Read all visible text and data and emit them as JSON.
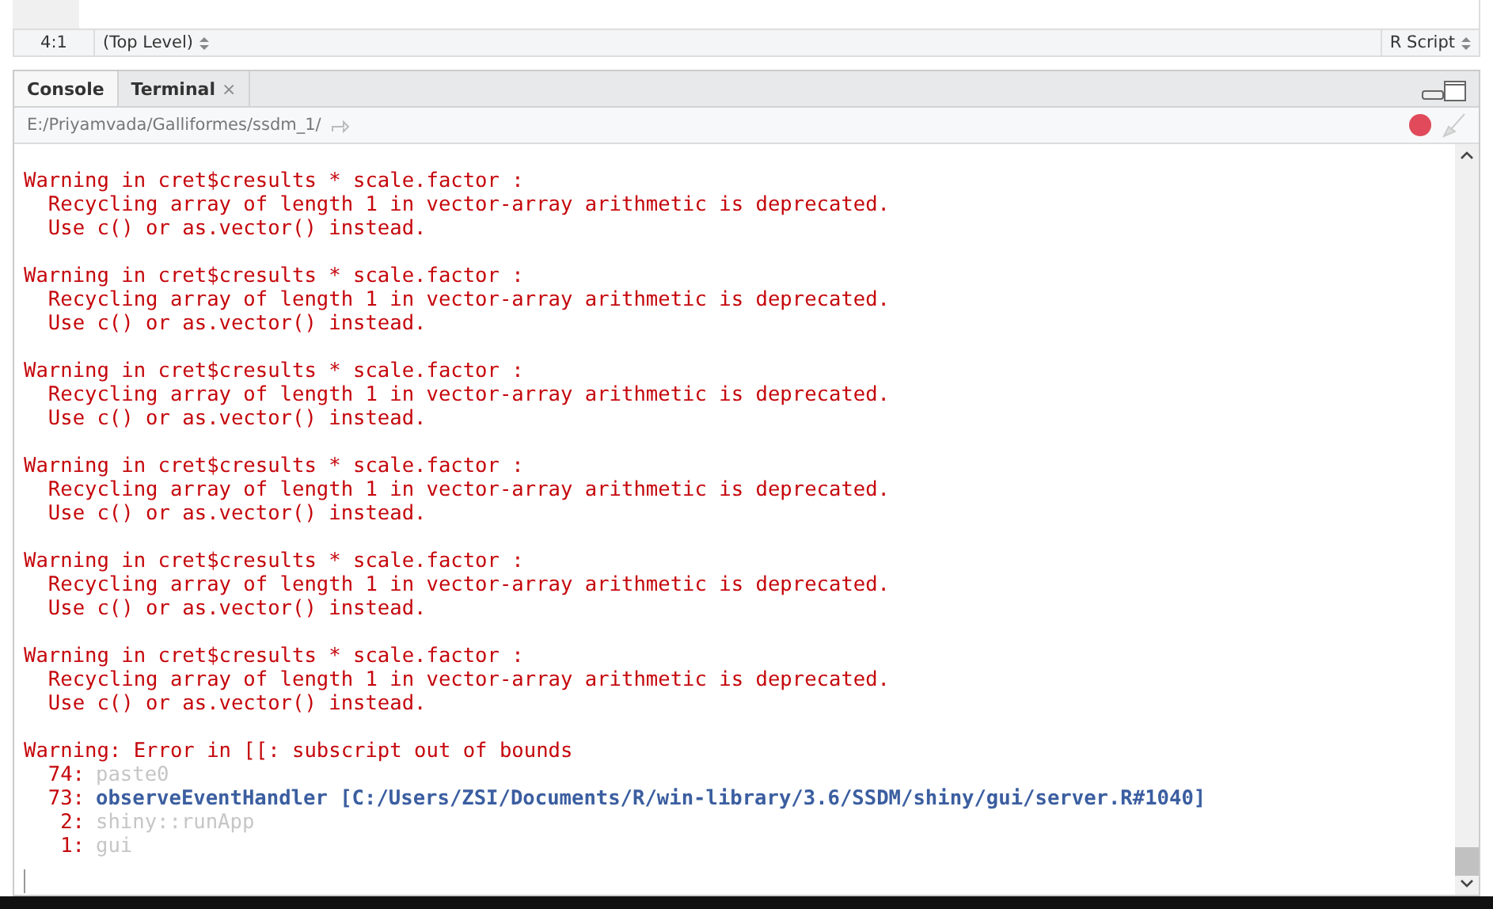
{
  "status_bar": {
    "position": "4:1",
    "scope": "(Top Level)",
    "file_type": "R Script"
  },
  "tabs": [
    {
      "label": "Console",
      "selected": true
    },
    {
      "label": "Terminal",
      "selected": false,
      "close": "×"
    }
  ],
  "path": "E:/Priyamvada/Galliformes/ssdm_1/",
  "console": [
    {
      "kind": "warning",
      "header": "Warning in cret$cresults * scale.factor :",
      "lines": [
        "  Recycling array of length 1 in vector-array arithmetic is deprecated.",
        "  Use c() or as.vector() instead."
      ]
    },
    {
      "kind": "warning",
      "header": "Warning in cret$cresults * scale.factor :",
      "lines": [
        "  Recycling array of length 1 in vector-array arithmetic is deprecated.",
        "  Use c() or as.vector() instead."
      ]
    },
    {
      "kind": "warning",
      "header": "Warning in cret$cresults * scale.factor :",
      "lines": [
        "  Recycling array of length 1 in vector-array arithmetic is deprecated.",
        "  Use c() or as.vector() instead."
      ]
    },
    {
      "kind": "warning",
      "header": "Warning in cret$cresults * scale.factor :",
      "lines": [
        "  Recycling array of length 1 in vector-array arithmetic is deprecated.",
        "  Use c() or as.vector() instead."
      ]
    },
    {
      "kind": "warning",
      "header": "Warning in cret$cresults * scale.factor :",
      "lines": [
        "  Recycling array of length 1 in vector-array arithmetic is deprecated.",
        "  Use c() or as.vector() instead."
      ]
    },
    {
      "kind": "warning",
      "header": "Warning in cret$cresults * scale.factor :",
      "lines": [
        "  Recycling array of length 1 in vector-array arithmetic is deprecated.",
        "  Use c() or as.vector() instead."
      ]
    },
    {
      "kind": "error",
      "header": "Warning: Error in [[: subscript out of bounds",
      "traceback": [
        {
          "num": "74:",
          "call": "paste0",
          "kind": "dim"
        },
        {
          "num": "73:",
          "call": "observeEventHandler [C:/Users/ZSI/Documents/R/win-library/3.6/SSDM/shiny/gui/server.R#1040]",
          "kind": "link"
        },
        {
          "num": " 2:",
          "call": "shiny::runApp",
          "kind": "dim"
        },
        {
          "num": " 1:",
          "call": "gui",
          "kind": "dim"
        }
      ]
    }
  ]
}
